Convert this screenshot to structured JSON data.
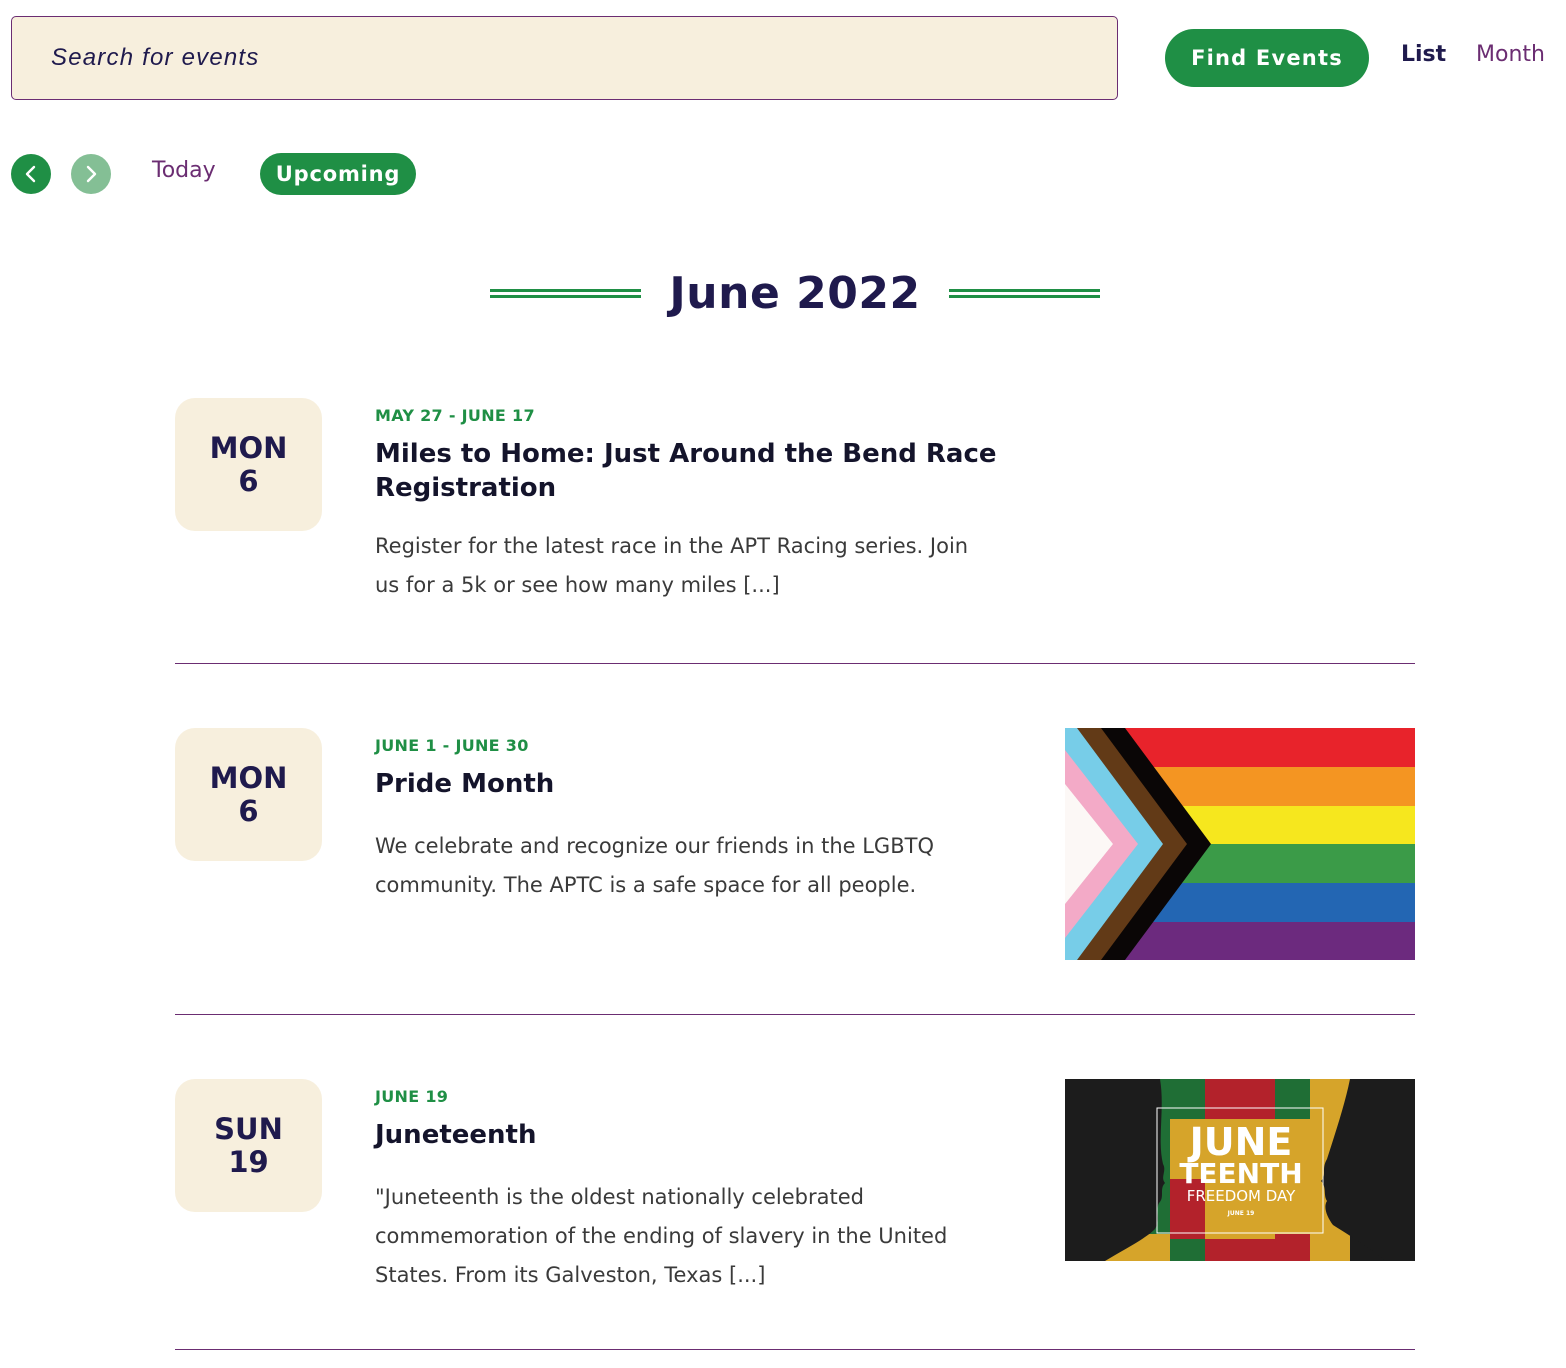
{
  "search": {
    "placeholder": "Search for events",
    "value": "",
    "submit_label": "Find Events"
  },
  "view_toggle": {
    "list_label": "List",
    "month_label": "Month",
    "active": "List"
  },
  "nav": {
    "prev_icon": "chevron-left-icon",
    "next_icon": "chevron-right-icon",
    "today_label": "Today",
    "upcoming_label": "Upcoming"
  },
  "month_heading": "June 2022",
  "colors": {
    "brand_green": "#1f8f45",
    "brand_purple": "#6b2d72",
    "navy": "#1f1a4d",
    "cream": "#f7efdd"
  },
  "events": [
    {
      "weekday": "MON",
      "day": "6",
      "range": "MAY 27 - JUNE 17",
      "title": "Miles to Home: Just Around the Bend Race Registration",
      "description": "Register for the latest race in the APT Racing series. Join us for a 5k or see how many miles [...]",
      "image": null
    },
    {
      "weekday": "MON",
      "day": "6",
      "range": "JUNE 1 - JUNE 30",
      "title": "Pride Month",
      "description": "We celebrate and recognize our friends in the LGBTQ community. The APTC is a safe space for all people.",
      "image": "progress-pride-flag"
    },
    {
      "weekday": "SUN",
      "day": "19",
      "range": "JUNE 19",
      "title": "Juneteenth",
      "description": "\"Juneteenth is the oldest nationally celebrated commemoration of the ending of slavery in the United States. From its Galveston, Texas [...]",
      "image": "juneteenth-banner",
      "image_text": {
        "line1": "JUNE",
        "line2": "TEENTH",
        "line3": "FREEDOM DAY",
        "line4": "JUNE 19"
      }
    }
  ]
}
